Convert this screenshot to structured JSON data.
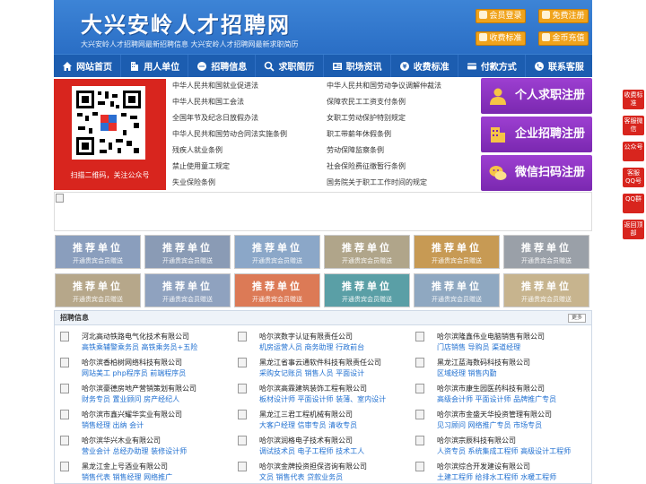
{
  "header": {
    "site_title": "大兴安岭人才招聘网",
    "subtitle": "大兴安岭人才招聘网最新招聘信息    大兴安岭人才招聘网最新求职简历",
    "buttons": [
      "会员登录",
      "免费注册",
      "收费标准",
      "金币充值"
    ]
  },
  "nav": {
    "items": [
      {
        "label": "网站首页",
        "icon": "home-icon"
      },
      {
        "label": "用人单位",
        "icon": "building-icon"
      },
      {
        "label": "招聘信息",
        "icon": "chat-icon"
      },
      {
        "label": "求职简历",
        "icon": "search-icon"
      },
      {
        "label": "职场资讯",
        "icon": "news-icon"
      },
      {
        "label": "收费标准",
        "icon": "money-icon"
      },
      {
        "label": "付款方式",
        "icon": "card-icon"
      },
      {
        "label": "联系客服",
        "icon": "phone-icon"
      }
    ]
  },
  "qr": {
    "caption": "扫描二维码，关注公众号"
  },
  "laws": {
    "left": [
      "中华人民共和国就业促进法",
      "中华人民共和国工会法",
      "全国年节及纪念日放假办法",
      "中华人民共和国劳动合同法实施条例",
      "残疾人就业条例",
      "禁止使用童工规定",
      "失业保险条例"
    ],
    "right": [
      "中华人民共和国劳动争议调解仲裁法",
      "保障农民工工资支付条例",
      "女职工劳动保护特别规定",
      "职工带薪年休假条例",
      "劳动保障监察条例",
      "社会保险费征缴暂行条例",
      "国务院关于职工工作时间的规定"
    ]
  },
  "register": {
    "personal": "个人求职注册",
    "company": "企业招聘注册",
    "wechat": "微信扫码注册"
  },
  "recommend": {
    "title": "推荐单位",
    "subtitle": "开通贵宾会员赠送",
    "colors": [
      "#8a9ebd",
      "#8a9bb5",
      "#8ba7c8",
      "#b0a58a",
      "#c79a54",
      "#9aa0a8",
      "#b6a78a",
      "#8fa2bf",
      "#dc7a56",
      "#5a9fa6",
      "#8fa8c1",
      "#c7b48e"
    ]
  },
  "jobs": {
    "title": "招聘信息",
    "more": "更多",
    "list": [
      {
        "company": "河北高动铁路电气化技术有限公司",
        "positions": "高铁乘辅警乘务员 高铁乘务员+五险"
      },
      {
        "company": "哈尔滨数字认证有限责任公司",
        "positions": "机房运营人员 商务助理 行政前台"
      },
      {
        "company": "哈尔滨隆鑫伟业电脑销售有限公司",
        "positions": "门店销售 导购员 渠道经理"
      },
      {
        "company": "哈尔滨香柏树网络科技有限公司",
        "positions": "网站美工 php程序员 前端程序员"
      },
      {
        "company": "黑龙江省事云通软件科技有限责任公司",
        "positions": "采购女记账员 销售人员 平面设计"
      },
      {
        "company": "黑龙江蓝海数码科技有限公司",
        "positions": "区域经理 销售内勤"
      },
      {
        "company": "哈尔滨豪德房地产营销策划有限公司",
        "positions": "财务专员 置业顾问 房产经纪人"
      },
      {
        "company": "哈尔滨高霖建筑装饰工程有限公司",
        "positions": "板材设计师 平面设计师 装薄、室内设计"
      },
      {
        "company": "哈尔滨市康生园医药科技有限公司",
        "positions": "高级会计师 平面设计师 品牌推广专员"
      },
      {
        "company": "哈尔滨市鑫兴耀华实业有限公司",
        "positions": "销售经理 出纳 会计"
      },
      {
        "company": "黑龙江三君工程机械有限公司",
        "positions": "大客户经理 信审专员 清收专员"
      },
      {
        "company": "哈尔滨市金盛天华投资管理有限公司",
        "positions": "见习顾问 网络推广专员 市场专员"
      },
      {
        "company": "哈尔滨华兴木业有限公司",
        "positions": "营业会计 总经办助理 装修设计师"
      },
      {
        "company": "哈尔滨润格电子技术有限公司",
        "positions": "调试技术员 电子工程师 技术工人"
      },
      {
        "company": "哈尔滨宗辰科技有限公司",
        "positions": "人资专员 系统集成工程师 高级设计工程师"
      },
      {
        "company": "黑龙江金上号酒业有限公司",
        "positions": "销售代表 销售经理 网络推广"
      },
      {
        "company": "哈尔滨金牌投资担保咨询有限公司",
        "positions": "文员 销售代表 贷款业务员"
      },
      {
        "company": "哈尔滨综合开发建设有限公司",
        "positions": "土建工程师 给排水工程师 水暖工程师"
      }
    ]
  },
  "float": [
    "收费标准",
    "客服微信",
    "公众号",
    "客服QQ号",
    "QQ群",
    "返回顶部"
  ]
}
